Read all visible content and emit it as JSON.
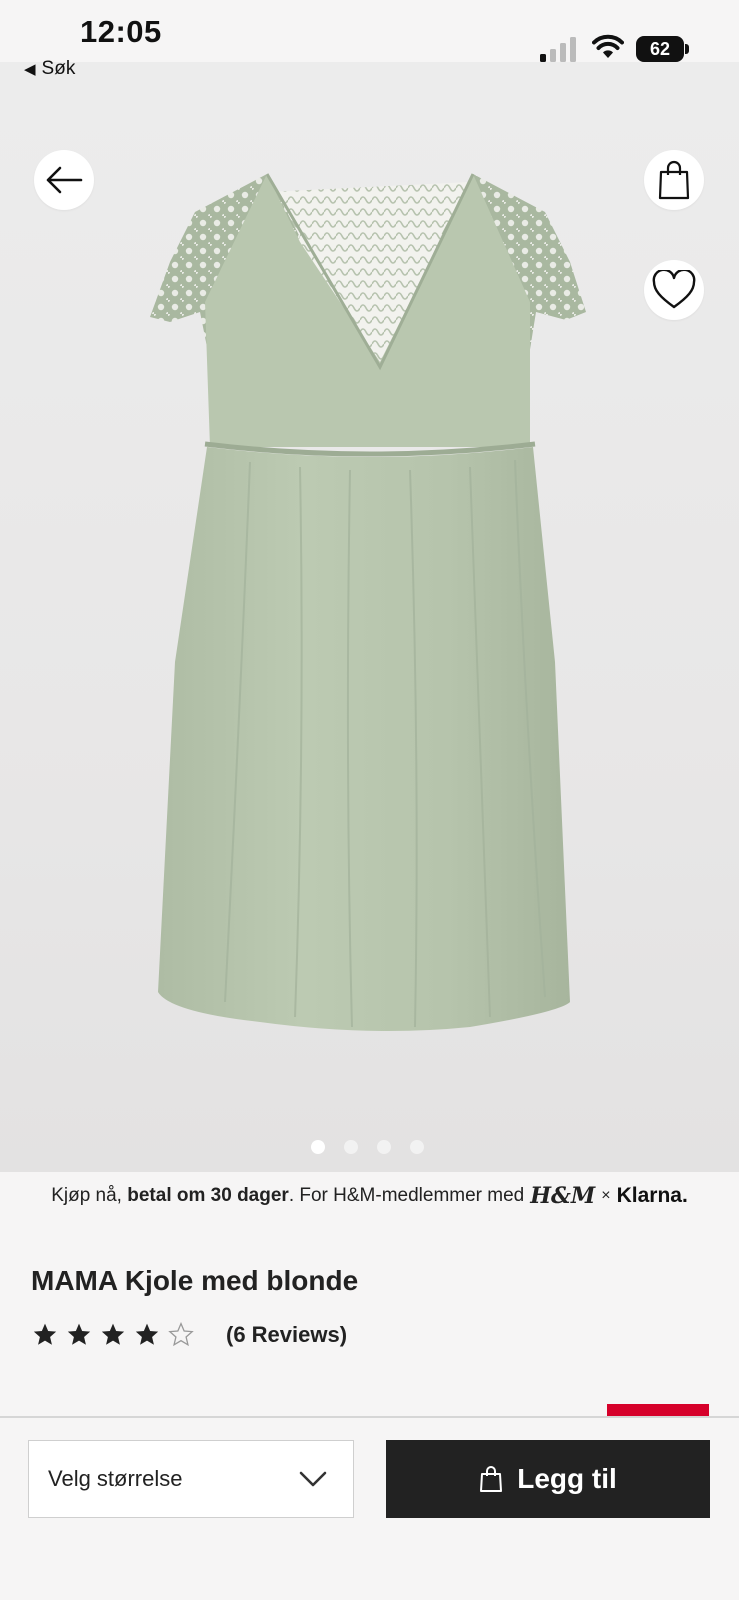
{
  "status_bar": {
    "time": "12:05",
    "back_app_label": "Søk",
    "battery_level": "62"
  },
  "gallery": {
    "image_count": 4,
    "active_index": 0,
    "product_color": "#b7c5ae"
  },
  "promo": {
    "prefix": "Kjøp nå, ",
    "bold": "betal om 30 dager",
    "suffix": ". For H&M-medlemmer med",
    "hm_logo": "H&M",
    "times": "×",
    "klarna_logo": "Klarna."
  },
  "product": {
    "title": "MAMA Kjole med blonde",
    "rating_value": 4,
    "rating_max": 5,
    "reviews_label": "(6 Reviews)"
  },
  "actions": {
    "size_select_label": "Velg størrelse",
    "add_to_cart_label": "Legg til"
  },
  "colors": {
    "accent_red": "#d6002a",
    "button_dark": "#222222"
  },
  "icons": {
    "back": "arrow-left-icon",
    "bag": "shopping-bag-icon",
    "favorite": "heart-icon",
    "chevron": "chevron-down-icon"
  }
}
